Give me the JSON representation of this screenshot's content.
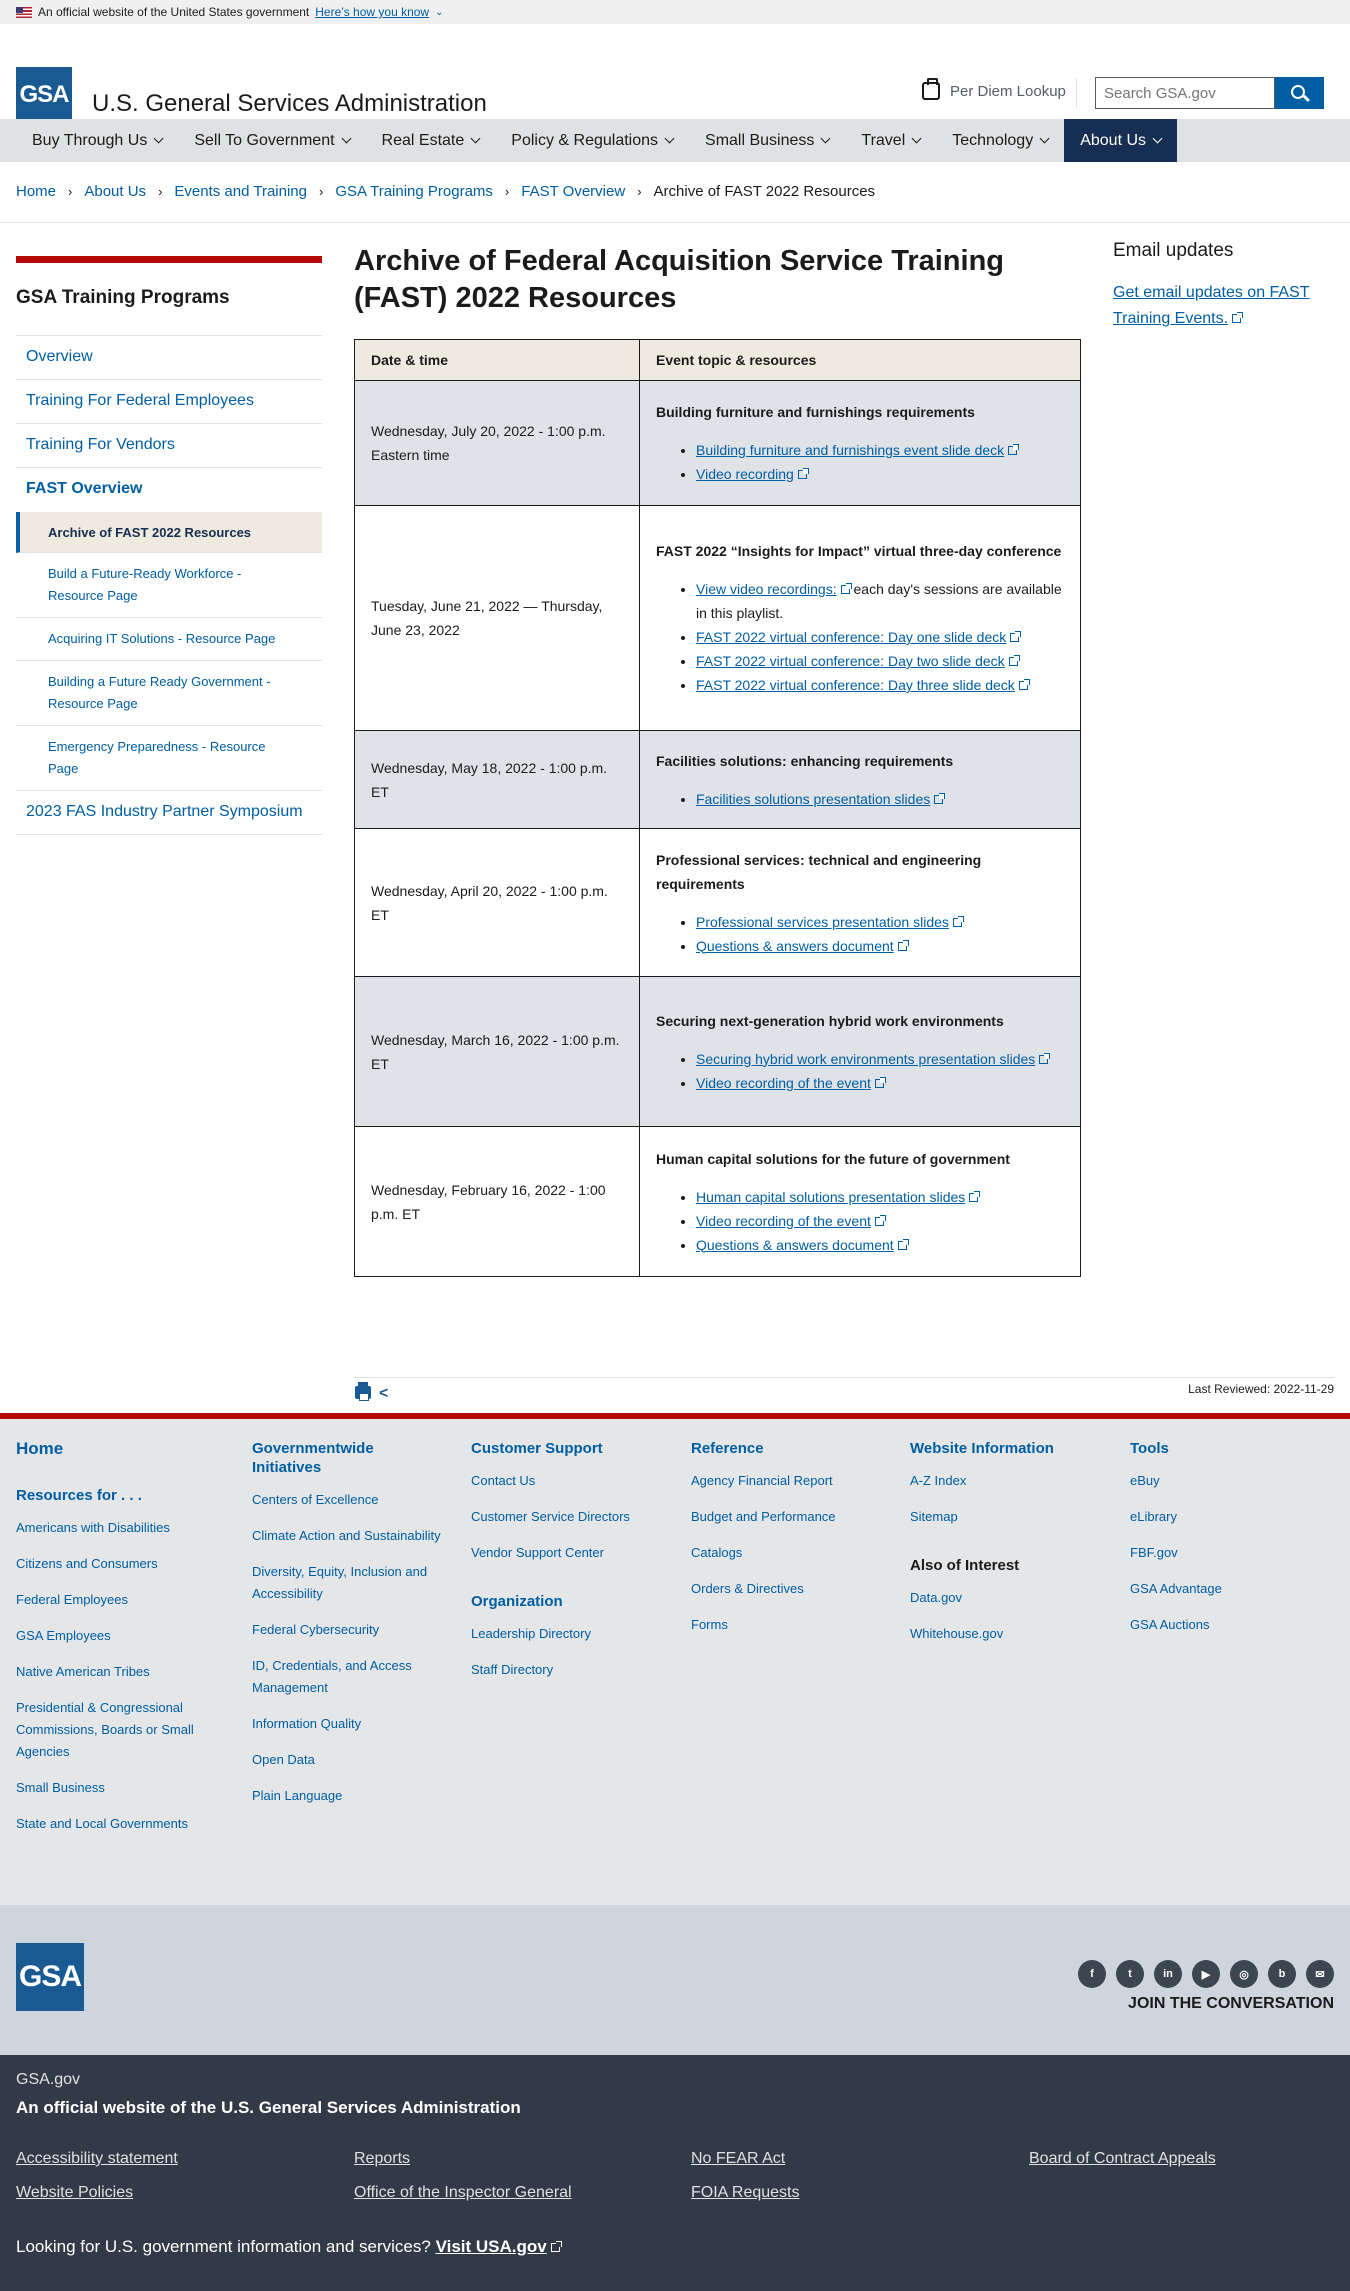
{
  "banner": {
    "text": "An official website of the United States government",
    "link": "Here’s how you know"
  },
  "header": {
    "logo": "GSA",
    "title": "U.S. General Services Administration",
    "per_diem": "Per Diem Lookup",
    "search_placeholder": "Search GSA.gov"
  },
  "nav": [
    "Buy Through Us",
    "Sell To Government",
    "Real Estate",
    "Policy & Regulations",
    "Small Business",
    "Travel",
    "Technology",
    "About Us"
  ],
  "breadcrumb": [
    "Home",
    "About Us",
    "Events and Training",
    "GSA Training Programs",
    "FAST Overview",
    "Archive of FAST 2022 Resources"
  ],
  "sidenav": {
    "heading": "GSA Training Programs",
    "items": [
      "Overview",
      "Training For Federal Employees",
      "Training For Vendors",
      "FAST Overview"
    ],
    "subitems": [
      "Archive of FAST 2022 Resources",
      "Build a Future-Ready Workforce - Resource Page",
      "Acquiring IT Solutions - Resource Page",
      "Building a Future Ready Government - Resource Page",
      "Emergency Preparedness - Resource Page"
    ],
    "last": "2023 FAS Industry Partner Symposium"
  },
  "page_title": "Archive of Federal Acquisition Service Training (FAST) 2022 Resources",
  "table": {
    "headers": [
      "Date & time",
      "Event topic & resources"
    ],
    "rows": [
      {
        "date": "Wednesday, July 20, 2022 - 1:00 p.m. Eastern time",
        "topic": "Building furniture and furnishings requirements",
        "links": [
          "Building furniture and furnishings event slide deck",
          "Video recording"
        ],
        "note": ""
      },
      {
        "date": "Tuesday, June 21, 2022 — Thursday, June 23, 2022",
        "topic": "FAST 2022 “Insights for Impact” virtual three-day conference",
        "links": [
          "View video recordings:",
          "FAST 2022 virtual conference: Day one slide deck",
          "FAST 2022 virtual conference: Day two slide deck",
          "FAST 2022 virtual conference: Day three slide deck"
        ],
        "note": " each day's sessions are available in this playlist."
      },
      {
        "date": "Wednesday, May 18, 2022 - 1:00 p.m. ET",
        "topic": "Facilities solutions: enhancing requirements",
        "links": [
          "Facilities solutions presentation slides"
        ],
        "note": ""
      },
      {
        "date": "Wednesday, April 20, 2022 - 1:00 p.m. ET",
        "topic": "Professional services: technical and engineering requirements",
        "links": [
          "Professional services presentation slides",
          "Questions & answers document"
        ],
        "note": ""
      },
      {
        "date": "Wednesday, March 16, 2022 - 1:00 p.m. ET",
        "topic": "Securing next-generation hybrid work environments",
        "links": [
          "Securing hybrid work environments presentation slides",
          "Video recording of the event"
        ],
        "note": ""
      },
      {
        "date": "Wednesday, February 16, 2022 - 1:00 p.m. ET",
        "topic": "Human capital solutions for the future of government",
        "links": [
          "Human capital solutions presentation slides",
          "Video recording of the event",
          "Questions & answers document"
        ],
        "note": ""
      }
    ]
  },
  "email": {
    "heading": "Email updates",
    "link": "Get email updates on FAST Training Events."
  },
  "last_reviewed": "Last Reviewed: 2022-11-29",
  "footer": {
    "home": "Home",
    "resources_heading": "Resources for . . .",
    "resources": [
      "Americans with Disabilities",
      "Citizens and Consumers",
      "Federal Employees",
      "GSA Employees",
      "Native American Tribes",
      "Presidential & Congressional Commissions, Boards or Small Agencies",
      "Small Business",
      "State and Local Governments"
    ],
    "gov_heading": "Governmentwide Initiatives",
    "gov": [
      "Centers of Excellence",
      "Climate Action and Sustainability",
      "Diversity, Equity, Inclusion and Accessibility",
      "Federal Cybersecurity",
      "ID, Credentials, and Access Management",
      "Information Quality",
      "Open Data",
      "Plain Language"
    ],
    "cs_heading": "Customer Support",
    "cs": [
      "Contact Us",
      "Customer Service Directors",
      "Vendor Support Center"
    ],
    "org_heading": "Organization",
    "org": [
      "Leadership Directory",
      "Staff Directory"
    ],
    "ref_heading": "Reference",
    "ref": [
      "Agency Financial Report",
      "Budget and Performance",
      "Catalogs",
      "Orders & Directives",
      "Forms"
    ],
    "web_heading": "Website Information",
    "web": [
      "A-Z Index",
      "Sitemap"
    ],
    "aoi_heading": "Also of Interest",
    "aoi": [
      "Data.gov",
      "Whitehouse.gov"
    ],
    "tools_heading": "Tools",
    "tools": [
      "eBuy",
      "eLibrary",
      "FBF.gov",
      "GSA Advantage",
      "GSA Auctions"
    ]
  },
  "social": {
    "join": "JOIN THE CONVERSATION",
    "icons": [
      "facebook-icon",
      "twitter-icon",
      "linkedin-icon",
      "youtube-icon",
      "instagram-icon",
      "blog-icon",
      "email-icon"
    ]
  },
  "bottom": {
    "site": "GSA.gov",
    "official": "An official website of the U.S. General Services Administration",
    "links": [
      "Accessibility statement",
      "Reports",
      "No FEAR Act",
      "Board of Contract Appeals",
      "Website Policies",
      "Office of the Inspector General",
      "FOIA Requests"
    ],
    "usa_text": "Looking for U.S. government information and services?",
    "usa_link": "Visit USA.gov"
  }
}
